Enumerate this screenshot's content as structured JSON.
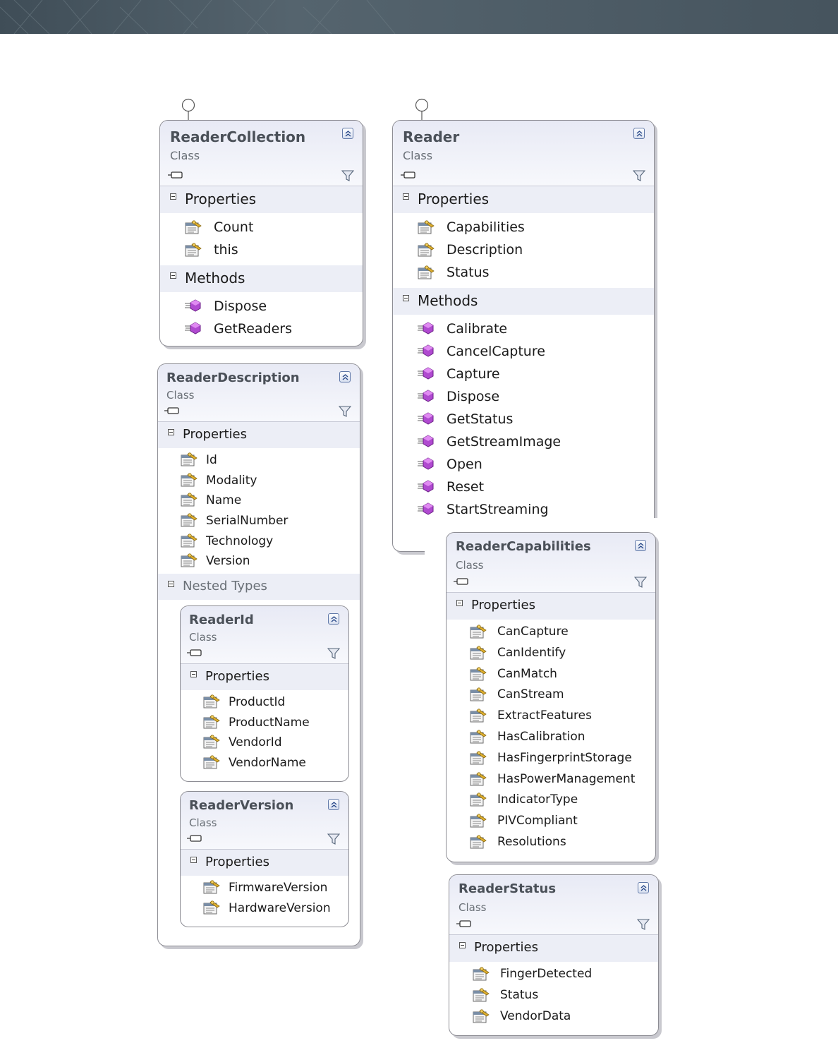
{
  "classes": {
    "reader_collection": {
      "name": "ReaderCollection",
      "stereotype": "Class",
      "sections": [
        {
          "label": "Properties",
          "kind": "property",
          "items": [
            "Count",
            "this"
          ]
        },
        {
          "label": "Methods",
          "kind": "method",
          "items": [
            "Dispose",
            "GetReaders"
          ]
        }
      ]
    },
    "reader": {
      "name": "Reader",
      "stereotype": "Class",
      "sections": [
        {
          "label": "Properties",
          "kind": "property",
          "items": [
            "Capabilities",
            "Description",
            "Status"
          ]
        },
        {
          "label": "Methods",
          "kind": "method",
          "items": [
            "Calibrate",
            "CancelCapture",
            "Capture",
            "Dispose",
            "GetStatus",
            "GetStreamImage",
            "Open",
            "Reset",
            "StartStreaming"
          ]
        }
      ]
    },
    "reader_description": {
      "name": "ReaderDescription",
      "stereotype": "Class",
      "sections": [
        {
          "label": "Properties",
          "kind": "property",
          "items": [
            "Id",
            "Modality",
            "Name",
            "SerialNumber",
            "Technology",
            "Version"
          ]
        },
        {
          "label": "Nested Types",
          "kind": "nested",
          "items": []
        }
      ]
    },
    "reader_id": {
      "name": "ReaderId",
      "stereotype": "Class",
      "sections": [
        {
          "label": "Properties",
          "kind": "property",
          "items": [
            "ProductId",
            "ProductName",
            "VendorId",
            "VendorName"
          ]
        }
      ]
    },
    "reader_version": {
      "name": "ReaderVersion",
      "stereotype": "Class",
      "sections": [
        {
          "label": "Properties",
          "kind": "property",
          "items": [
            "FirmwareVersion",
            "HardwareVersion"
          ]
        }
      ]
    },
    "reader_capabilities": {
      "name": "ReaderCapabilities",
      "stereotype": "Class",
      "sections": [
        {
          "label": "Properties",
          "kind": "property",
          "items": [
            "CanCapture",
            "CanIdentify",
            "CanMatch",
            "CanStream",
            "ExtractFeatures",
            "HasCalibration",
            "HasFingerprintStorage",
            "HasPowerManagement",
            "IndicatorType",
            "PIVCompliant",
            "Resolutions"
          ]
        }
      ]
    },
    "reader_status": {
      "name": "ReaderStatus",
      "stereotype": "Class",
      "sections": [
        {
          "label": "Properties",
          "kind": "property",
          "items": [
            "FingerDetected",
            "Status",
            "VendorData"
          ]
        }
      ]
    }
  },
  "icons": {
    "property": "property-icon",
    "method": "method-icon",
    "collapse": "collapse-chevrons-icon",
    "filter": "filter-icon",
    "interface": "interface-lollipop-icon"
  },
  "colors": {
    "banner": "#4f5e68",
    "header_gradient_top": "#e8eaf5",
    "section_band": "#eceef6",
    "border": "#8d8d94",
    "method_icon": "#b04ad0"
  }
}
